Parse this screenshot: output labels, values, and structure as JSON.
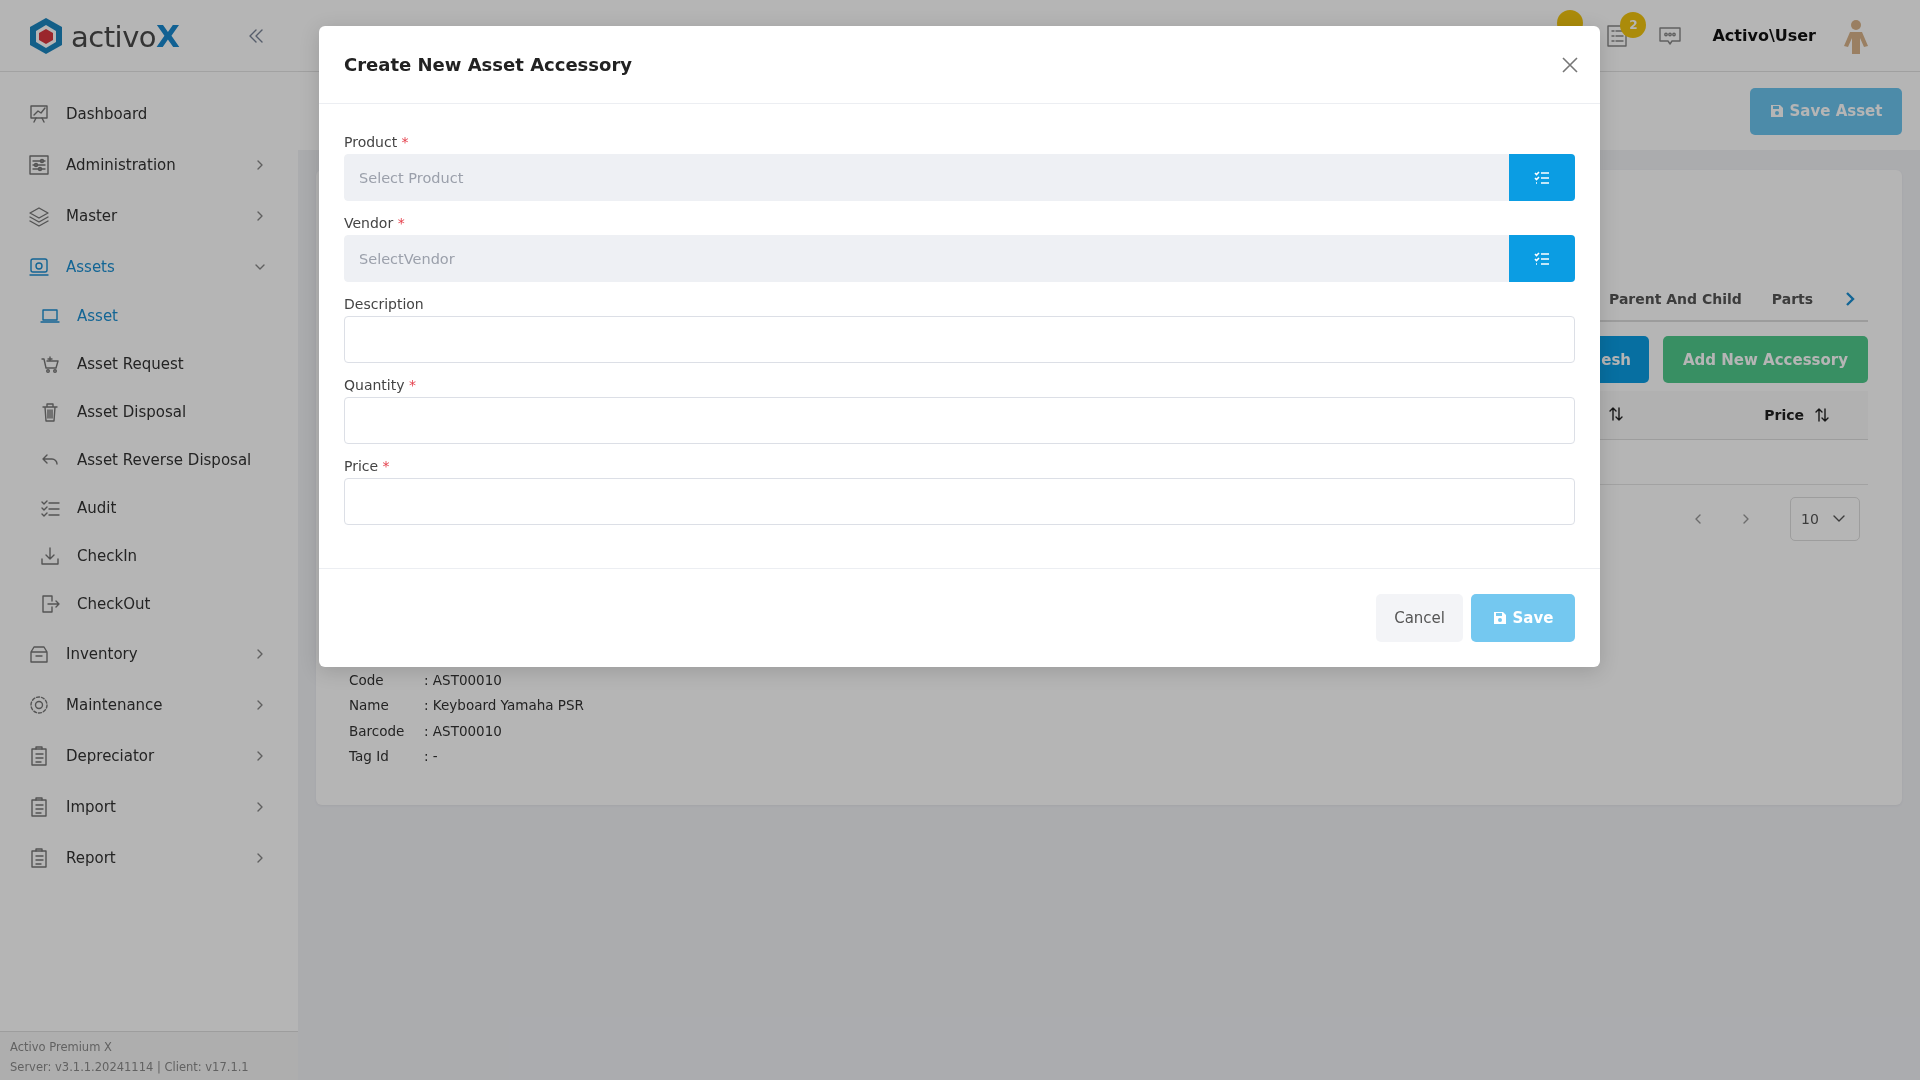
{
  "logo": {
    "name": "activo",
    "suffix": "X"
  },
  "sidebar": {
    "items": [
      {
        "label": "Dashboard",
        "selected": false
      },
      {
        "label": "Administration",
        "selected": false,
        "expanded": false
      },
      {
        "label": "Master",
        "selected": false,
        "expanded": false
      },
      {
        "label": "Assets",
        "selected": true,
        "expanded": true,
        "children": [
          {
            "label": "Asset",
            "selected": true
          },
          {
            "label": "Asset Request",
            "selected": false
          },
          {
            "label": "Asset Disposal",
            "selected": false
          },
          {
            "label": "Asset Reverse Disposal",
            "selected": false
          },
          {
            "label": "Audit",
            "selected": false
          },
          {
            "label": "CheckIn",
            "selected": false
          },
          {
            "label": "CheckOut",
            "selected": false
          }
        ]
      },
      {
        "label": "Inventory",
        "selected": false,
        "expanded": false
      },
      {
        "label": "Maintenance",
        "selected": false,
        "expanded": false
      },
      {
        "label": "Depreciator",
        "selected": false,
        "expanded": false
      },
      {
        "label": "Import",
        "selected": false,
        "expanded": false
      },
      {
        "label": "Report",
        "selected": false,
        "expanded": false
      }
    ],
    "footer": [
      "Activo Premium X",
      "Server: v3.1.1.20241114 | Client: v17.1.1"
    ]
  },
  "header": {
    "tasks_badge": "2",
    "user": "Activo\\User"
  },
  "toolbar": {
    "save_button": "Save Asset"
  },
  "asset_card": {
    "tabs": [
      {
        "label": "Parent And Child",
        "selected": false
      },
      {
        "label": "Parts",
        "selected": false
      }
    ],
    "refresh_button": "esh",
    "add_button": "Add New Accessory",
    "table": {
      "columns": [
        {
          "label": "Price"
        }
      ]
    },
    "page_size": "10",
    "details": [
      {
        "label": "Code",
        "value": ": AST00010"
      },
      {
        "label": "Name",
        "value": ": Keyboard Yamaha PSR"
      },
      {
        "label": "Barcode",
        "value": ": AST00010"
      },
      {
        "label": "Tag Id",
        "value": ": -"
      }
    ]
  },
  "modal": {
    "title": "Create New Asset Accessory",
    "fields": [
      {
        "kind": "lookup",
        "label": "Product",
        "required_mark": "*",
        "placeholder": "Select Product"
      },
      {
        "kind": "lookup",
        "label": "Vendor",
        "required_mark": "*",
        "placeholder": "SelectVendor"
      },
      {
        "kind": "text",
        "label": "Description"
      },
      {
        "kind": "text",
        "label": "Quantity",
        "required_mark": "*"
      },
      {
        "kind": "text",
        "label": "Price",
        "required_mark": "*"
      }
    ],
    "cancel_button": "Cancel",
    "save_button": "Save"
  }
}
